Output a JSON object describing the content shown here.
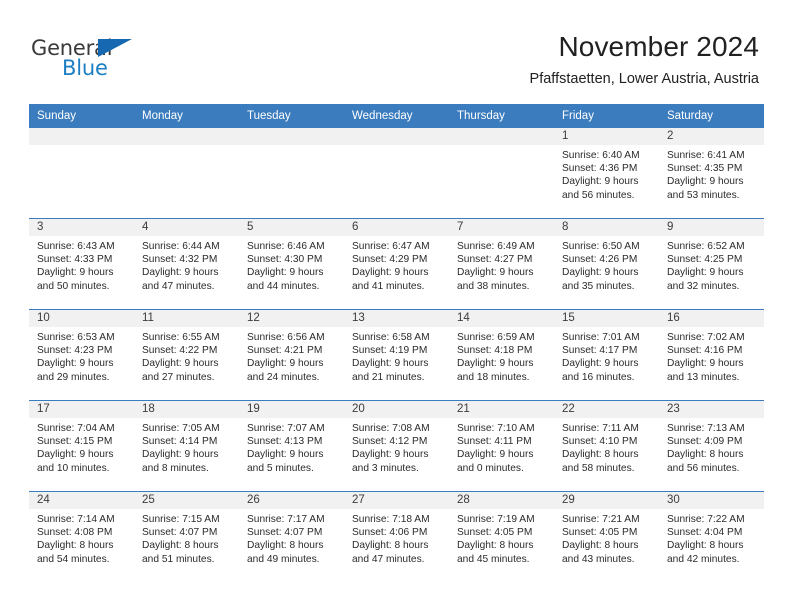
{
  "brand": {
    "name_top": "General",
    "name_bottom": "Blue",
    "flag_icon": "triangle-flag-icon",
    "color_top": "#3a3a3a",
    "color_bottom": "#1d7fc3",
    "flag_color": "#1668b0"
  },
  "header": {
    "title": "November 2024",
    "subtitle": "Pfaffstaetten, Lower Austria, Austria"
  },
  "theme": {
    "header_bg": "#3a7cbe",
    "header_text": "#ffffff",
    "daynum_band_bg": "#f1f1f1",
    "cell_bg": "#ffffff",
    "row_divider": "#3a7cbe"
  },
  "calendar": {
    "weekday_headers": [
      "Sunday",
      "Monday",
      "Tuesday",
      "Wednesday",
      "Thursday",
      "Friday",
      "Saturday"
    ],
    "weeks": [
      [
        {
          "day": "",
          "lines": []
        },
        {
          "day": "",
          "lines": []
        },
        {
          "day": "",
          "lines": []
        },
        {
          "day": "",
          "lines": []
        },
        {
          "day": "",
          "lines": []
        },
        {
          "day": "1",
          "lines": [
            "Sunrise: 6:40 AM",
            "Sunset: 4:36 PM",
            "Daylight: 9 hours",
            "and 56 minutes."
          ]
        },
        {
          "day": "2",
          "lines": [
            "Sunrise: 6:41 AM",
            "Sunset: 4:35 PM",
            "Daylight: 9 hours",
            "and 53 minutes."
          ]
        }
      ],
      [
        {
          "day": "3",
          "lines": [
            "Sunrise: 6:43 AM",
            "Sunset: 4:33 PM",
            "Daylight: 9 hours",
            "and 50 minutes."
          ]
        },
        {
          "day": "4",
          "lines": [
            "Sunrise: 6:44 AM",
            "Sunset: 4:32 PM",
            "Daylight: 9 hours",
            "and 47 minutes."
          ]
        },
        {
          "day": "5",
          "lines": [
            "Sunrise: 6:46 AM",
            "Sunset: 4:30 PM",
            "Daylight: 9 hours",
            "and 44 minutes."
          ]
        },
        {
          "day": "6",
          "lines": [
            "Sunrise: 6:47 AM",
            "Sunset: 4:29 PM",
            "Daylight: 9 hours",
            "and 41 minutes."
          ]
        },
        {
          "day": "7",
          "lines": [
            "Sunrise: 6:49 AM",
            "Sunset: 4:27 PM",
            "Daylight: 9 hours",
            "and 38 minutes."
          ]
        },
        {
          "day": "8",
          "lines": [
            "Sunrise: 6:50 AM",
            "Sunset: 4:26 PM",
            "Daylight: 9 hours",
            "and 35 minutes."
          ]
        },
        {
          "day": "9",
          "lines": [
            "Sunrise: 6:52 AM",
            "Sunset: 4:25 PM",
            "Daylight: 9 hours",
            "and 32 minutes."
          ]
        }
      ],
      [
        {
          "day": "10",
          "lines": [
            "Sunrise: 6:53 AM",
            "Sunset: 4:23 PM",
            "Daylight: 9 hours",
            "and 29 minutes."
          ]
        },
        {
          "day": "11",
          "lines": [
            "Sunrise: 6:55 AM",
            "Sunset: 4:22 PM",
            "Daylight: 9 hours",
            "and 27 minutes."
          ]
        },
        {
          "day": "12",
          "lines": [
            "Sunrise: 6:56 AM",
            "Sunset: 4:21 PM",
            "Daylight: 9 hours",
            "and 24 minutes."
          ]
        },
        {
          "day": "13",
          "lines": [
            "Sunrise: 6:58 AM",
            "Sunset: 4:19 PM",
            "Daylight: 9 hours",
            "and 21 minutes."
          ]
        },
        {
          "day": "14",
          "lines": [
            "Sunrise: 6:59 AM",
            "Sunset: 4:18 PM",
            "Daylight: 9 hours",
            "and 18 minutes."
          ]
        },
        {
          "day": "15",
          "lines": [
            "Sunrise: 7:01 AM",
            "Sunset: 4:17 PM",
            "Daylight: 9 hours",
            "and 16 minutes."
          ]
        },
        {
          "day": "16",
          "lines": [
            "Sunrise: 7:02 AM",
            "Sunset: 4:16 PM",
            "Daylight: 9 hours",
            "and 13 minutes."
          ]
        }
      ],
      [
        {
          "day": "17",
          "lines": [
            "Sunrise: 7:04 AM",
            "Sunset: 4:15 PM",
            "Daylight: 9 hours",
            "and 10 minutes."
          ]
        },
        {
          "day": "18",
          "lines": [
            "Sunrise: 7:05 AM",
            "Sunset: 4:14 PM",
            "Daylight: 9 hours",
            "and 8 minutes."
          ]
        },
        {
          "day": "19",
          "lines": [
            "Sunrise: 7:07 AM",
            "Sunset: 4:13 PM",
            "Daylight: 9 hours",
            "and 5 minutes."
          ]
        },
        {
          "day": "20",
          "lines": [
            "Sunrise: 7:08 AM",
            "Sunset: 4:12 PM",
            "Daylight: 9 hours",
            "and 3 minutes."
          ]
        },
        {
          "day": "21",
          "lines": [
            "Sunrise: 7:10 AM",
            "Sunset: 4:11 PM",
            "Daylight: 9 hours",
            "and 0 minutes."
          ]
        },
        {
          "day": "22",
          "lines": [
            "Sunrise: 7:11 AM",
            "Sunset: 4:10 PM",
            "Daylight: 8 hours",
            "and 58 minutes."
          ]
        },
        {
          "day": "23",
          "lines": [
            "Sunrise: 7:13 AM",
            "Sunset: 4:09 PM",
            "Daylight: 8 hours",
            "and 56 minutes."
          ]
        }
      ],
      [
        {
          "day": "24",
          "lines": [
            "Sunrise: 7:14 AM",
            "Sunset: 4:08 PM",
            "Daylight: 8 hours",
            "and 54 minutes."
          ]
        },
        {
          "day": "25",
          "lines": [
            "Sunrise: 7:15 AM",
            "Sunset: 4:07 PM",
            "Daylight: 8 hours",
            "and 51 minutes."
          ]
        },
        {
          "day": "26",
          "lines": [
            "Sunrise: 7:17 AM",
            "Sunset: 4:07 PM",
            "Daylight: 8 hours",
            "and 49 minutes."
          ]
        },
        {
          "day": "27",
          "lines": [
            "Sunrise: 7:18 AM",
            "Sunset: 4:06 PM",
            "Daylight: 8 hours",
            "and 47 minutes."
          ]
        },
        {
          "day": "28",
          "lines": [
            "Sunrise: 7:19 AM",
            "Sunset: 4:05 PM",
            "Daylight: 8 hours",
            "and 45 minutes."
          ]
        },
        {
          "day": "29",
          "lines": [
            "Sunrise: 7:21 AM",
            "Sunset: 4:05 PM",
            "Daylight: 8 hours",
            "and 43 minutes."
          ]
        },
        {
          "day": "30",
          "lines": [
            "Sunrise: 7:22 AM",
            "Sunset: 4:04 PM",
            "Daylight: 8 hours",
            "and 42 minutes."
          ]
        }
      ]
    ]
  }
}
